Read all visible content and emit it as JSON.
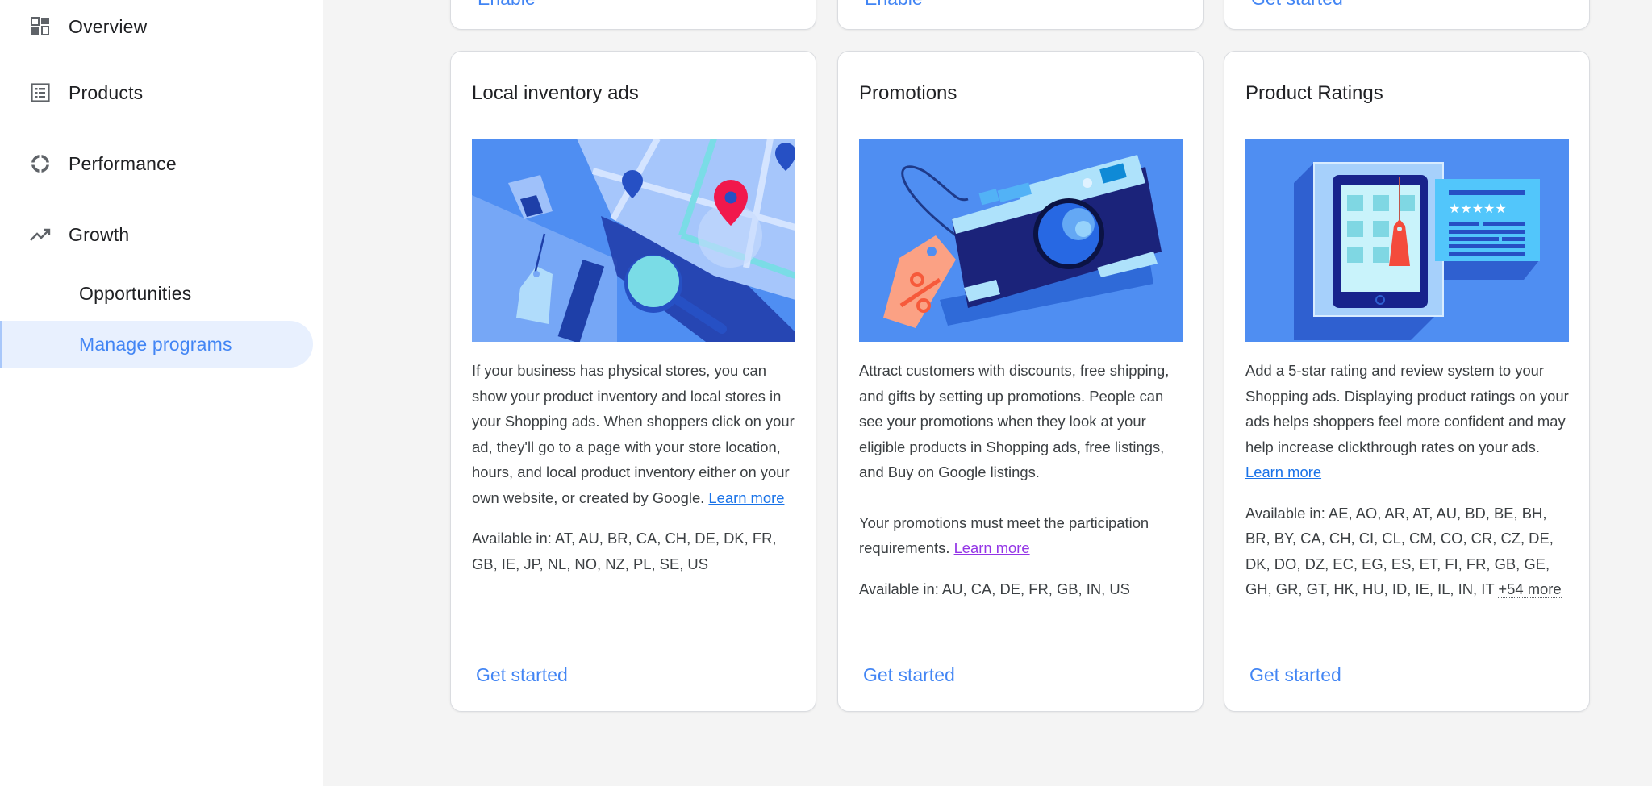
{
  "sidebar": {
    "items": [
      {
        "label": "Overview",
        "icon": "dashboard-icon"
      },
      {
        "label": "Products",
        "icon": "list-icon"
      },
      {
        "label": "Performance",
        "icon": "donut-chart-icon"
      },
      {
        "label": "Growth",
        "icon": "trending-up-icon"
      },
      {
        "label": "Opportunities"
      },
      {
        "label": "Manage programs",
        "active": true
      }
    ]
  },
  "top_row": [
    {
      "action": "Enable"
    },
    {
      "action": "Enable"
    },
    {
      "action": "Get started"
    }
  ],
  "cards": [
    {
      "title": "Local inventory ads",
      "description": "If your business has physical stores, you can show your product inventory and local stores in your Shopping ads. When shoppers click on your ad, they'll go to a page with your store location, hours, and local product inventory either on your own website, or created by Google.",
      "learn_more": "Learn more",
      "available_in": "Available in: AT, AU, BR, CA, CH, DE, DK, FR, GB, IE, JP, NL, NO, NZ, PL, SE, US",
      "action": "Get started"
    },
    {
      "title": "Promotions",
      "description": "Attract customers with discounts, free shipping, and gifts by setting up promotions. People can see your promotions when they look at your eligible products in Shopping ads, free listings, and Buy on Google listings.",
      "requirements": "Your promotions must meet the participation requirements.",
      "learn_more": "Learn more",
      "available_in": "Available in: AU, CA, DE, FR, GB, IN, US",
      "action": "Get started"
    },
    {
      "title": "Product Ratings",
      "description": "Add a 5-star rating and review system to your Shopping ads. Displaying product ratings on your ads helps shoppers feel more confident and may help increase clickthrough rates on your ads.",
      "learn_more": "Learn more",
      "available_in": "Available in: AE, AO, AR, AT, AU, BD, BE, BH, BR, BY, CA, CH, CI, CL, CM, CO, CR, CZ, DE, DK, DO, DZ, EC, EG, ES, ET, FI, FR, GB, GE, GH, GR, GT, HK, HU, ID, IE, IL, IN, IT",
      "more_countries": "+54 more",
      "action": "Get started"
    }
  ],
  "colors": {
    "accent": "#4285f4",
    "link": "#1a73e8",
    "visited_link": "#9334e6",
    "active_nav_bg": "#e8f0fe",
    "page_bg": "#f4f4f4"
  }
}
